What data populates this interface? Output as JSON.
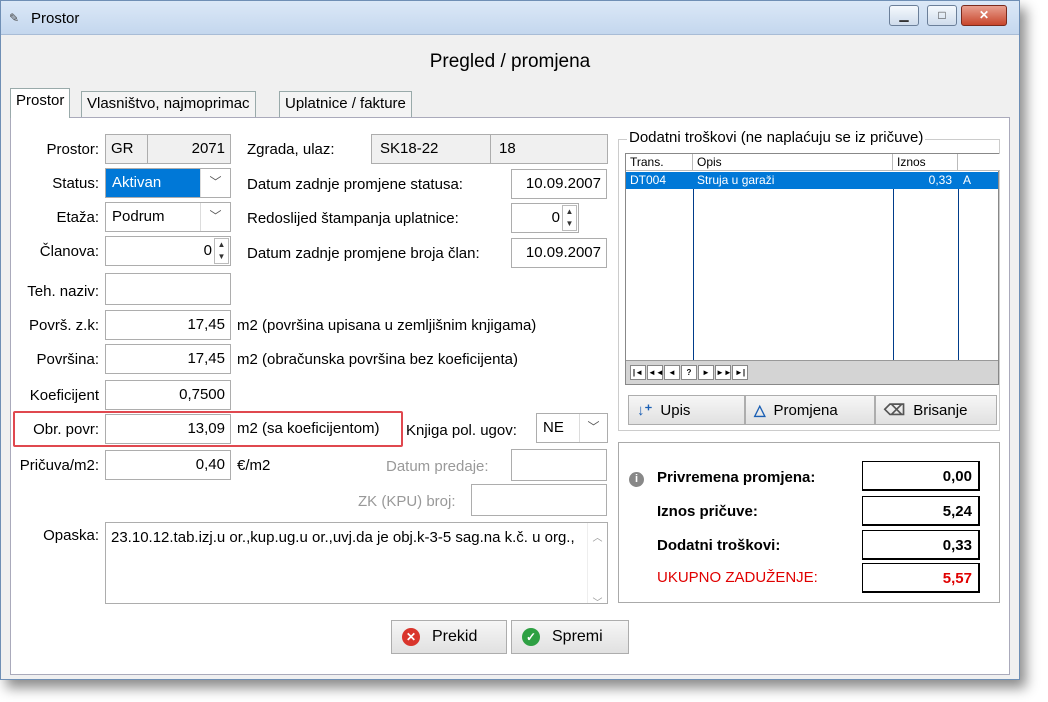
{
  "window": {
    "title": "Prostor"
  },
  "page_title": "Pregled / promjena",
  "tabs": [
    {
      "label": "Prostor"
    },
    {
      "label": "Vlasništvo, najmoprimac"
    },
    {
      "label": "Uplatnice / fakture"
    }
  ],
  "form": {
    "prostor_label": "Prostor:",
    "prostor_code": "GR",
    "prostor_number": "2071",
    "status_label": "Status:",
    "status_value": "Aktivan",
    "etaza_label": "Etaža:",
    "etaza_value": "Podrum",
    "clanova_label": "Članova:",
    "clanova_value": "0",
    "teh_naziv_label": "Teh. naziv:",
    "teh_naziv_value": "",
    "povrs_zk_label": "Površ. z.k:",
    "povrs_zk_value": "17,45",
    "povrs_zk_unit": "m2  (površina upisana u zemljišnim knjigama)",
    "povrsina_label": "Površina:",
    "povrsina_value": "17,45",
    "povrsina_unit": "m2  (obračunska površina bez koeficijenta)",
    "koef_label": "Koeficijent",
    "koef_value": "0,7500",
    "obr_povr_label": "Obr. povr:",
    "obr_povr_value": "13,09",
    "obr_povr_unit": "m2 (sa koeficijentom)",
    "pricuva_label": "Pričuva/m2:",
    "pricuva_value": "0,40",
    "pricuva_unit": "€/m2",
    "zgrada_label": "Zgrada, ulaz:",
    "zgrada_value": "SK18-22",
    "ulaz_value": "18",
    "datum_status_label": "Datum zadnje promjene statusa:",
    "datum_status_value": "10.09.2007",
    "redoslijed_label": "Redoslijed štampanja uplatnice:",
    "redoslijed_value": "0",
    "datum_clan_label": "Datum zadnje promjene broja član:",
    "datum_clan_value": "10.09.2007",
    "knjiga_label": "Knjiga pol. ugov:",
    "knjiga_value": "NE",
    "datum_predaje_label": "Datum predaje:",
    "datum_predaje_value": "",
    "zk_label": "ZK (KPU) broj:",
    "zk_value": "",
    "opaska_label": "Opaska:",
    "opaska_value": "23.10.12.tab.izj.u or.,kup.ug.u or.,uvj.da je obj.k-3-5  sag.na k.č. u org.,"
  },
  "costs": {
    "title": "Dodatni troškovi  (ne naplaćuju se iz pričuve)",
    "columns": [
      "Trans.",
      "Opis",
      "Iznos"
    ],
    "rows": [
      {
        "trans": "DT004",
        "opis": "Struja u garaži",
        "iznos": "0,33",
        "flag": "A"
      }
    ],
    "nav": [
      "|◄",
      "◄◄",
      "◄",
      "?",
      "►",
      "►►",
      "►|"
    ],
    "buttons": {
      "upis": "Upis",
      "promjena": "Promjena",
      "brisanje": "Brisanje"
    }
  },
  "summary": {
    "privremena_label": "Privremena promjena:",
    "privremena_value": "0,00",
    "iznos_label": "Iznos pričuve:",
    "iznos_value": "5,24",
    "dodatni_label": "Dodatni troškovi:",
    "dodatni_value": "0,33",
    "ukupno_label": "UKUPNO ZADUŽENJE:",
    "ukupno_value": "5,57"
  },
  "actions": {
    "prekid": "Prekid",
    "spremi": "Spremi"
  },
  "colors": {
    "accent": "#0078d7",
    "highlight": "#e0484f",
    "total": "#e00000"
  }
}
